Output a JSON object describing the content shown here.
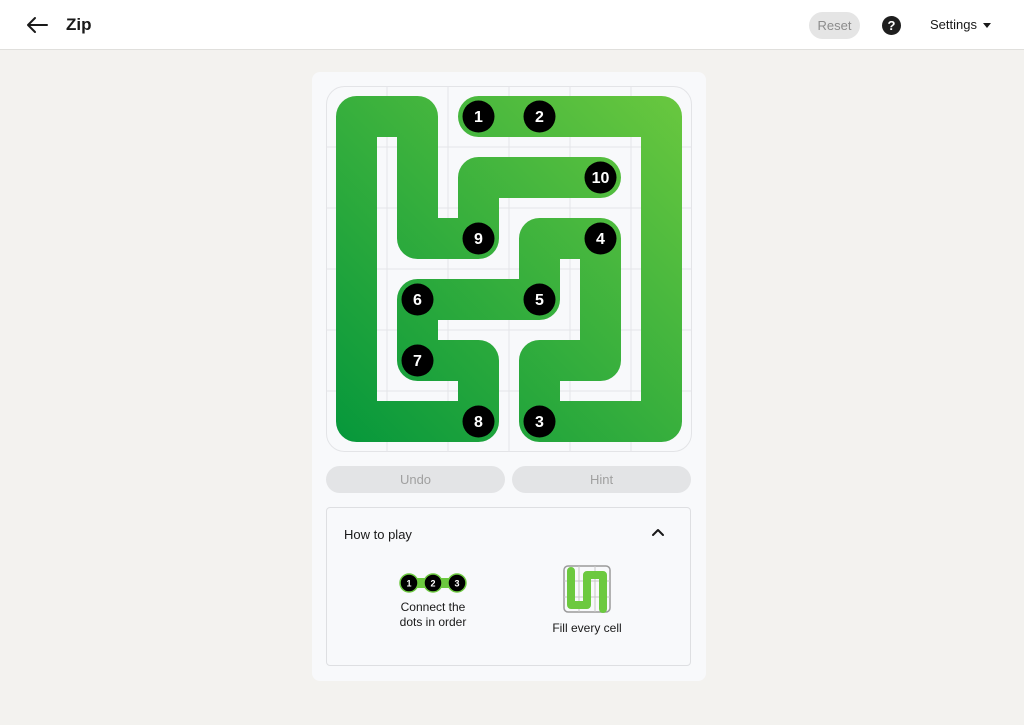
{
  "header": {
    "title": "Zip",
    "reset_label": "Reset",
    "help_label": "?",
    "settings_label": "Settings"
  },
  "board": {
    "rows": 6,
    "cols": 6,
    "dots": [
      {
        "label": "1",
        "row": 0,
        "col": 2
      },
      {
        "label": "2",
        "row": 0,
        "col": 3
      },
      {
        "label": "10",
        "row": 1,
        "col": 4
      },
      {
        "label": "9",
        "row": 2,
        "col": 2
      },
      {
        "label": "4",
        "row": 2,
        "col": 4
      },
      {
        "label": "6",
        "row": 3,
        "col": 1
      },
      {
        "label": "5",
        "row": 3,
        "col": 3
      },
      {
        "label": "7",
        "row": 4,
        "col": 1
      },
      {
        "label": "8",
        "row": 5,
        "col": 2
      },
      {
        "label": "3",
        "row": 5,
        "col": 3
      }
    ],
    "path": [
      [
        0,
        2
      ],
      [
        0,
        3
      ],
      [
        0,
        4
      ],
      [
        0,
        5
      ],
      [
        1,
        5
      ],
      [
        2,
        5
      ],
      [
        3,
        5
      ],
      [
        4,
        5
      ],
      [
        5,
        5
      ],
      [
        5,
        4
      ],
      [
        5,
        3
      ],
      [
        4,
        3
      ],
      [
        4,
        4
      ],
      [
        3,
        4
      ],
      [
        2,
        4
      ],
      [
        2,
        3
      ],
      [
        3,
        3
      ],
      [
        3,
        2
      ],
      [
        3,
        1
      ],
      [
        4,
        1
      ],
      [
        4,
        2
      ],
      [
        5,
        2
      ],
      [
        5,
        1
      ],
      [
        5,
        0
      ],
      [
        4,
        0
      ],
      [
        3,
        0
      ],
      [
        2,
        0
      ],
      [
        1,
        0
      ],
      [
        0,
        0
      ],
      [
        0,
        1
      ],
      [
        1,
        1
      ],
      [
        2,
        1
      ],
      [
        2,
        2
      ],
      [
        1,
        2
      ],
      [
        1,
        3
      ],
      [
        1,
        4
      ]
    ],
    "path_color_start": "#6cc93f",
    "path_color_end": "#03963b",
    "dot_color": "#000000"
  },
  "actions": {
    "undo_label": "Undo",
    "hint_label": "Hint"
  },
  "howto": {
    "title": "How to play",
    "tip1_text": "Connect the\ndots in order",
    "tip1_dots": [
      "1",
      "2",
      "3"
    ],
    "tip2_text": "Fill every cell"
  }
}
